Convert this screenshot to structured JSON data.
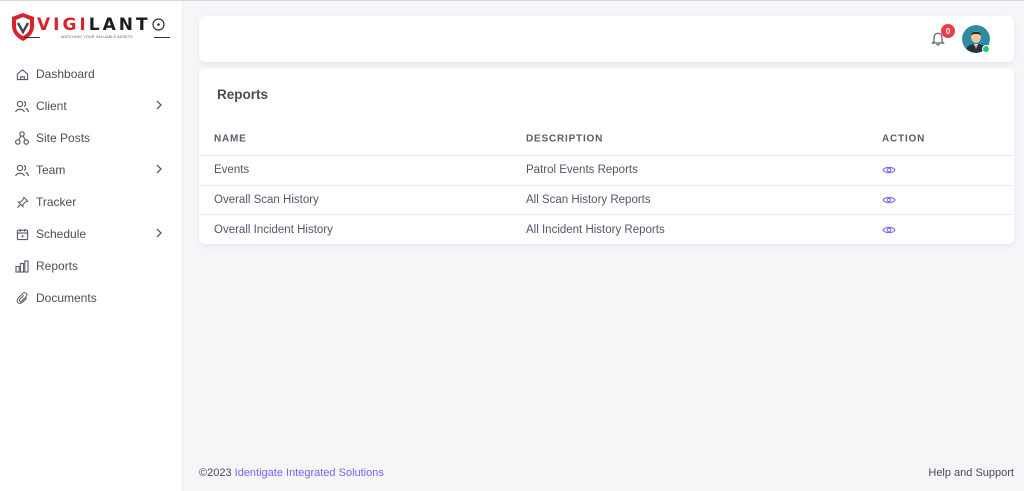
{
  "brand": {
    "name_red": "VIGI",
    "name_dark": "LANT",
    "tagline": "WATCHING YOUR VALUABLE ASSETS",
    "accent_color": "#d8232a"
  },
  "sidebar": {
    "items": [
      {
        "label": "Dashboard",
        "icon": "home-icon",
        "has_submenu": false
      },
      {
        "label": "Client",
        "icon": "users-icon",
        "has_submenu": true
      },
      {
        "label": "Site Posts",
        "icon": "sitemap-icon",
        "has_submenu": false
      },
      {
        "label": "Team",
        "icon": "users-icon",
        "has_submenu": true
      },
      {
        "label": "Tracker",
        "icon": "pin-icon",
        "has_submenu": false
      },
      {
        "label": "Schedule",
        "icon": "calendar-icon",
        "has_submenu": true
      },
      {
        "label": "Reports",
        "icon": "bar-chart-icon",
        "has_submenu": false
      },
      {
        "label": "Documents",
        "icon": "paperclip-icon",
        "has_submenu": false
      }
    ]
  },
  "topbar": {
    "notification_count": "0",
    "avatar_status_color": "#28c76f"
  },
  "reports": {
    "title": "Reports",
    "columns": [
      "NAME",
      "DESCRIPTION",
      "ACTION"
    ],
    "rows": [
      {
        "name": "Events",
        "description": "Patrol Events Reports",
        "action_icon": "eye-icon"
      },
      {
        "name": "Overall Scan History",
        "description": "All Scan History Reports",
        "action_icon": "eye-icon"
      },
      {
        "name": "Overall Incident History",
        "description": "All Incident History Reports",
        "action_icon": "eye-icon"
      }
    ]
  },
  "footer": {
    "copyright": "©2023",
    "company": "Identigate Integrated Solutions",
    "support": "Help and Support",
    "link_color": "#7367f0"
  }
}
